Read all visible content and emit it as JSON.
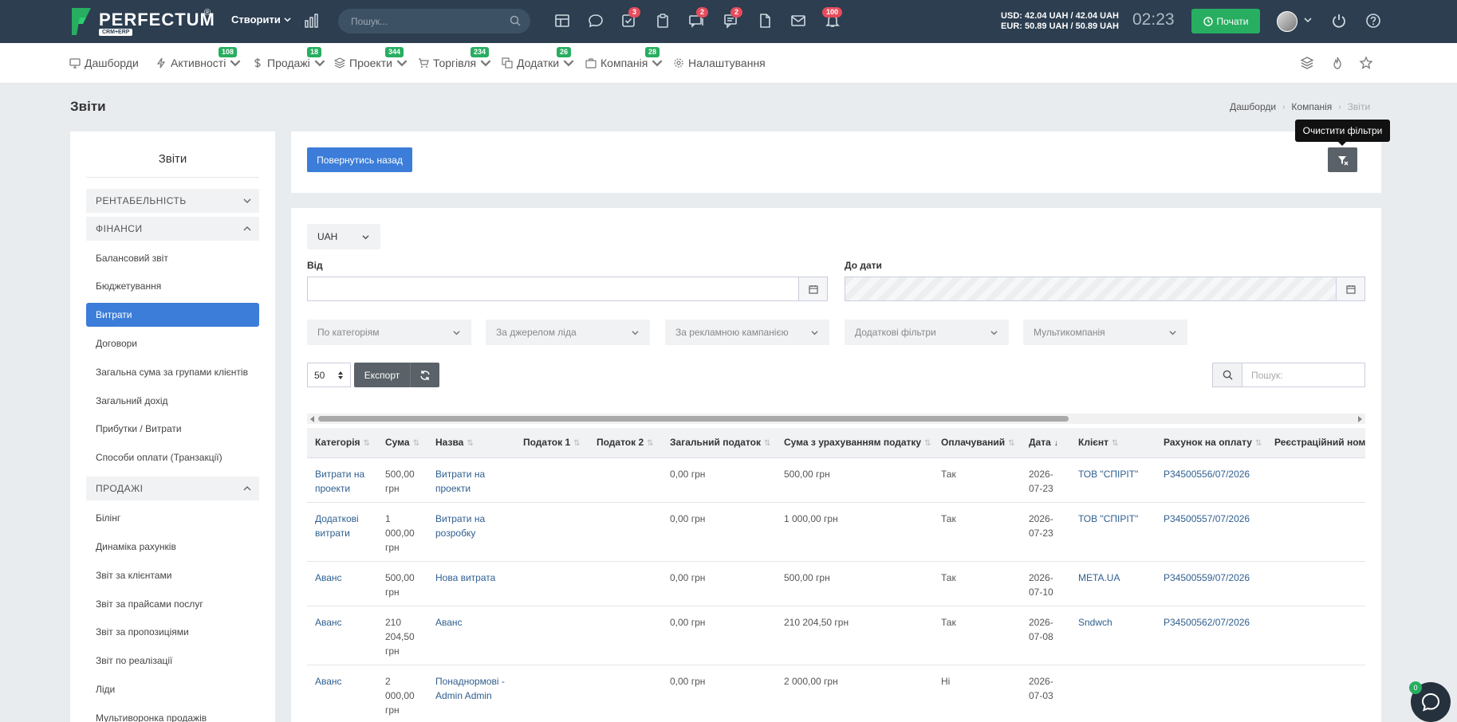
{
  "topbar": {
    "logo_text": "PERFECTUM",
    "logo_sub": "CRM+ERP",
    "logo_reg": "®",
    "create_label": "Створити",
    "search_placeholder": "Пошук...",
    "icons": [
      {
        "name": "table-icon",
        "badge": ""
      },
      {
        "name": "chat-icon",
        "badge": ""
      },
      {
        "name": "tasks-icon",
        "badge": "3"
      },
      {
        "name": "clipboard-icon",
        "badge": ""
      },
      {
        "name": "messages-icon",
        "badge": "2"
      },
      {
        "name": "comments-icon",
        "badge": "2"
      },
      {
        "name": "file-icon",
        "badge": ""
      },
      {
        "name": "mail-icon",
        "badge": ""
      },
      {
        "name": "notifications-icon",
        "badge": "100"
      }
    ],
    "currency_usd": "USD: 42.04 UAH / 42.04 UAH",
    "currency_eur": "EUR: 50.89 UAH / 50.89 UAH",
    "clock": "02:23",
    "start_label": "Почати"
  },
  "nav": {
    "items": [
      {
        "label": "Дашборди",
        "badge": ""
      },
      {
        "label": "Активності",
        "badge": "108"
      },
      {
        "label": "Продажі",
        "badge": "18"
      },
      {
        "label": "Проекти",
        "badge": "344"
      },
      {
        "label": "Торгівля",
        "badge": "234"
      },
      {
        "label": "Додатки",
        "badge": "26"
      },
      {
        "label": "Компанія",
        "badge": "28"
      },
      {
        "label": "Налаштування",
        "badge": ""
      }
    ]
  },
  "page": {
    "title": "Звіти",
    "breadcrumb": [
      "Дашборди",
      "Компанія",
      "Звіти"
    ]
  },
  "sidebar": {
    "title": "Звіти",
    "section_profitability": "РЕНТАБЕЛЬНІСТЬ",
    "section_finance": "ФІНАНСИ",
    "finance_links": [
      "Балансовий звіт",
      "Бюджетування",
      "Витрати",
      "Договори",
      "Загальна сума за групами клієнтів",
      "Загальний дохід",
      "Прибутки / Витрати",
      "Способи оплати (Транзакції)"
    ],
    "section_sales": "ПРОДАЖІ",
    "sales_links": [
      "Білінг",
      "Динаміка рахунків",
      "Звіт за клієнтами",
      "Звіт за прайсами послуг",
      "Звіт за пропозиціями",
      "Звіт по реалізації",
      "Ліди",
      "Мультиворонка продажів"
    ]
  },
  "actions": {
    "back_label": "Повернутись назад",
    "clear_tooltip": "Очистити фільтри"
  },
  "filters": {
    "currency": "UAH",
    "from_label": "Від",
    "to_label": "До дати",
    "selects": [
      "По категоріям",
      "За джерелом ліда",
      "За рекламною кампанією",
      "Додаткові фільтри",
      "Мультикомпанія"
    ],
    "per_page": "50",
    "export_label": "Експорт",
    "search_placeholder": "Пошук:"
  },
  "table": {
    "columns": [
      "Категорія",
      "Сума",
      "Назва",
      "Податок 1",
      "Податок 2",
      "Загальний податок",
      "Сума з урахуванням податку",
      "Оплачуваний",
      "Дата",
      "Клієнт",
      "Рахунок на оплату",
      "Реєстраційний номе"
    ],
    "rows": [
      {
        "cat": "Витрати на проекти",
        "sum": "500,00 грн",
        "name": "Витрати на проекти",
        "tax1": "",
        "tax2": "",
        "tax_total": "0,00 грн",
        "sum_tax": "500,00 грн",
        "paid": "Так",
        "date": "2026-07-23",
        "client": "ТОВ \"СПІРІТ\"",
        "invoice": "P34500556/07/2026",
        "reg": ""
      },
      {
        "cat": "Додаткові витрати",
        "sum": "1 000,00 грн",
        "name": "Витрати на розробку",
        "tax1": "",
        "tax2": "",
        "tax_total": "0,00 грн",
        "sum_tax": "1 000,00 грн",
        "paid": "Так",
        "date": "2026-07-23",
        "client": "ТОВ \"СПІРІТ\"",
        "invoice": "P34500557/07/2026",
        "reg": ""
      },
      {
        "cat": "Аванс",
        "sum": "500,00 грн",
        "name": "Нова витрата",
        "tax1": "",
        "tax2": "",
        "tax_total": "0,00 грн",
        "sum_tax": "500,00 грн",
        "paid": "Так",
        "date": "2026-07-10",
        "client": "META.UA",
        "invoice": "P34500559/07/2026",
        "reg": ""
      },
      {
        "cat": "Аванс",
        "sum": "210 204,50 грн",
        "name": "Аванс",
        "tax1": "",
        "tax2": "",
        "tax_total": "0,00 грн",
        "sum_tax": "210 204,50 грн",
        "paid": "Так",
        "date": "2026-07-08",
        "client": "Sndwch",
        "invoice": "P34500562/07/2026",
        "reg": ""
      },
      {
        "cat": "Аванс",
        "sum": "2 000,00 грн",
        "name": "Понаднормові - Admin Admin",
        "tax1": "",
        "tax2": "",
        "tax_total": "0,00 грн",
        "sum_tax": "2 000,00 грн",
        "paid": "Ні",
        "date": "2026-07-03",
        "client": "",
        "invoice": "",
        "reg": ""
      }
    ]
  },
  "chat": {
    "badge": "0"
  },
  "colors": {
    "topbar": "#2c3e50",
    "accent": "#3b7dd8",
    "green": "#27ae60",
    "badge_red": "#e74c5c"
  }
}
